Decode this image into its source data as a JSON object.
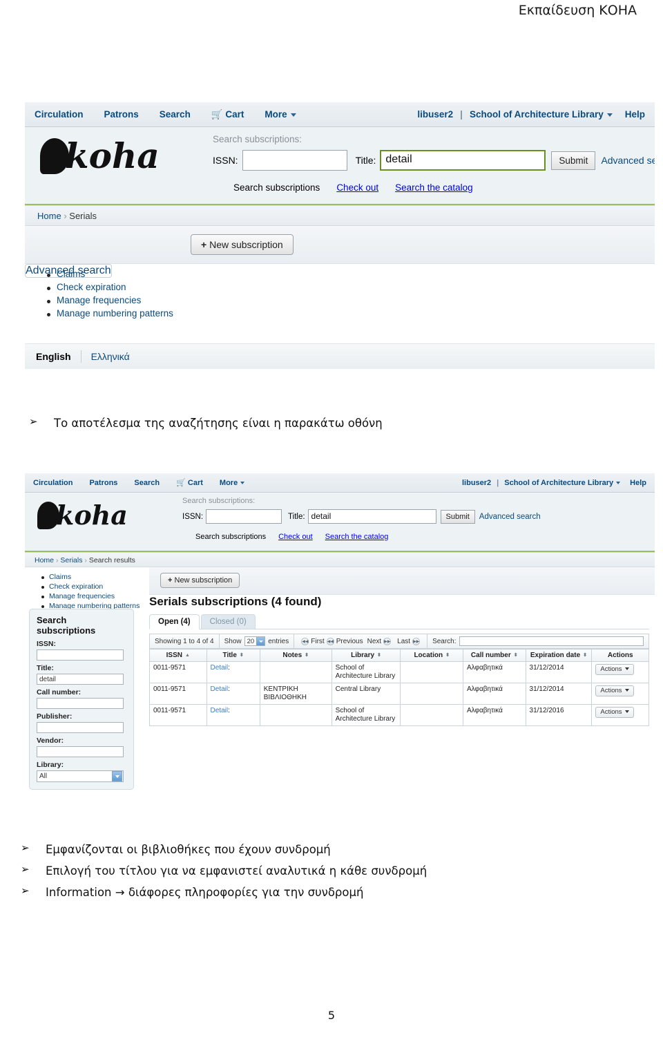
{
  "document": {
    "header_title": "Εκπαίδευση ΚΟΗΑ",
    "page_number": "5"
  },
  "screenshot1": {
    "topnav": {
      "items": [
        "Circulation",
        "Patrons",
        "Search",
        "Cart",
        "More"
      ],
      "user": "libuser2",
      "separator": "|",
      "branch": "School of Architecture Library",
      "help": "Help"
    },
    "logo_text": "koha",
    "search": {
      "caption": "Search subscriptions:",
      "issn_label": "ISSN:",
      "issn_value": "",
      "title_label": "Title:",
      "title_value": "detail",
      "submit_label": "Submit",
      "advanced_label": "Advanced search",
      "tabs": [
        "Search subscriptions",
        "Check out",
        "Search the catalog"
      ]
    },
    "breadcrumb": {
      "home": "Home",
      "arrow": "›",
      "current": "Serials"
    },
    "toolbar": {
      "advanced_search_label": "Advanced search",
      "new_subscription_label": "New subscription",
      "plus": "+"
    },
    "sidelinks": [
      "Claims",
      "Check expiration",
      "Manage frequencies",
      "Manage numbering patterns"
    ],
    "langbar": {
      "active": "English",
      "other": "Ελληνικά"
    }
  },
  "bullet_block_1": {
    "marker": "➢",
    "lines": [
      "Το αποτέλεσμα της αναζήτησης είναι η παρακάτω οθόνη"
    ]
  },
  "screenshot2": {
    "topnav": {
      "items": [
        "Circulation",
        "Patrons",
        "Search",
        "Cart",
        "More"
      ],
      "user": "libuser2",
      "separator": "|",
      "branch": "School of Architecture Library",
      "help": "Help"
    },
    "logo_text": "koha",
    "search": {
      "caption": "Search subscriptions:",
      "issn_label": "ISSN:",
      "issn_value": "",
      "title_label": "Title:",
      "title_value": "detail",
      "submit_label": "Submit",
      "advanced_label": "Advanced search",
      "tabs": [
        "Search subscriptions",
        "Check out",
        "Search the catalog"
      ]
    },
    "breadcrumb": {
      "home": "Home",
      "arrow": "›",
      "serials": "Serials",
      "current": "Search results"
    },
    "sidelinks": [
      "Claims",
      "Check expiration",
      "Manage frequencies",
      "Manage numbering patterns"
    ],
    "toolbar": {
      "new_subscription_label": "New subscription",
      "plus": "+"
    },
    "sidepanel": {
      "title_line1": "Search",
      "title_line2": "subscriptions",
      "fields": [
        {
          "label": "ISSN:",
          "value": ""
        },
        {
          "label": "Title:",
          "value": "detail"
        },
        {
          "label": "Call number:",
          "value": ""
        },
        {
          "label": "Publisher:",
          "value": ""
        },
        {
          "label": "Vendor:",
          "value": ""
        }
      ],
      "library_label": "Library:",
      "library_value": "All"
    },
    "results": {
      "heading": "Serials subscriptions (4 found)",
      "tabs": [
        {
          "label": "Open (4)",
          "state": "active"
        },
        {
          "label": "Closed (0)",
          "state": "idle"
        }
      ],
      "datatable_toolbar": {
        "showing": "Showing 1 to 4 of 4",
        "show_label": "Show",
        "show_value": "20",
        "entries_label": "entries",
        "first": "First",
        "previous": "Previous",
        "next": "Next",
        "last": "Last",
        "search_label": "Search:",
        "search_value": ""
      },
      "columns": [
        {
          "label": "ISSN",
          "sort": "asc"
        },
        {
          "label": "Title",
          "sort": "both"
        },
        {
          "label": "Notes",
          "sort": "both"
        },
        {
          "label": "Library",
          "sort": "both"
        },
        {
          "label": "Location",
          "sort": "both"
        },
        {
          "label": "Call number",
          "sort": "both"
        },
        {
          "label": "Expiration date",
          "sort": "both"
        },
        {
          "label": "Actions",
          "sort": "none"
        }
      ],
      "rows": [
        {
          "issn": "0011-9571",
          "title": "Detail",
          "title_suffix": ":",
          "notes": "",
          "library": "School of Architecture Library",
          "location": "",
          "call_number": "Αλφαβητικά",
          "expiration": "31/12/2014",
          "action": "Actions"
        },
        {
          "issn": "0011-9571",
          "title": "Detail",
          "title_suffix": ":",
          "notes": "ΚΕΝΤΡΙΚΗ ΒΙΒΛΙΟΘΗΚΗ",
          "library": "Central Library",
          "location": "",
          "call_number": "Αλφαβητικά",
          "expiration": "31/12/2014",
          "action": "Actions"
        },
        {
          "issn": "0011-9571",
          "title": "Detail",
          "title_suffix": ":",
          "notes": "",
          "library": "School of Architecture Library",
          "location": "",
          "call_number": "Αλφαβητικά",
          "expiration": "31/12/2016",
          "action": "Actions"
        }
      ]
    }
  },
  "bullet_block_2": {
    "marker": "➢",
    "lines": [
      "Εμφανίζονται οι βιβλιοθήκες που έχουν συνδρομή",
      "Επιλογή  του τίτλου για να εμφανιστεί αναλυτικά η κάθε συνδρομή",
      "Information  → διάφορες πληροφορίες για την συνδρομή"
    ]
  },
  "colors": {
    "nav_link": "#0a4a7d",
    "focus_border": "#6b8e23",
    "tab_underline": "#9bbf5e",
    "table_link": "#3a7fc1"
  }
}
